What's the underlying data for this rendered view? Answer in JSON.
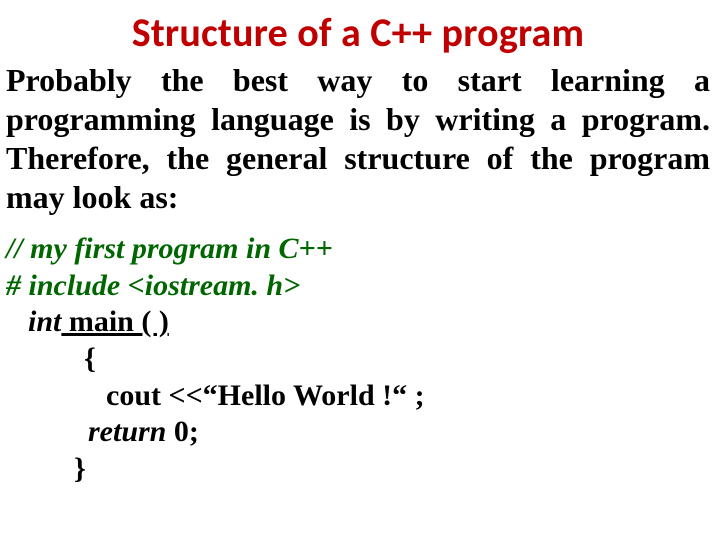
{
  "title": "Structure of a C++ program",
  "paragraph": "Probably the best way to start learning a programming language is by writing a program. Therefore, the general structure of the program may look as:",
  "code": {
    "comment": "// my first program in C++",
    "include": "# include <iostream. h>",
    "main_kw": "int",
    "main_rest": " main ( )",
    "brace_open": "{",
    "cout": "cout <<“Hello World !“ ;",
    "return_kw": "return",
    "return_rest": " 0;",
    "brace_close": "}"
  }
}
